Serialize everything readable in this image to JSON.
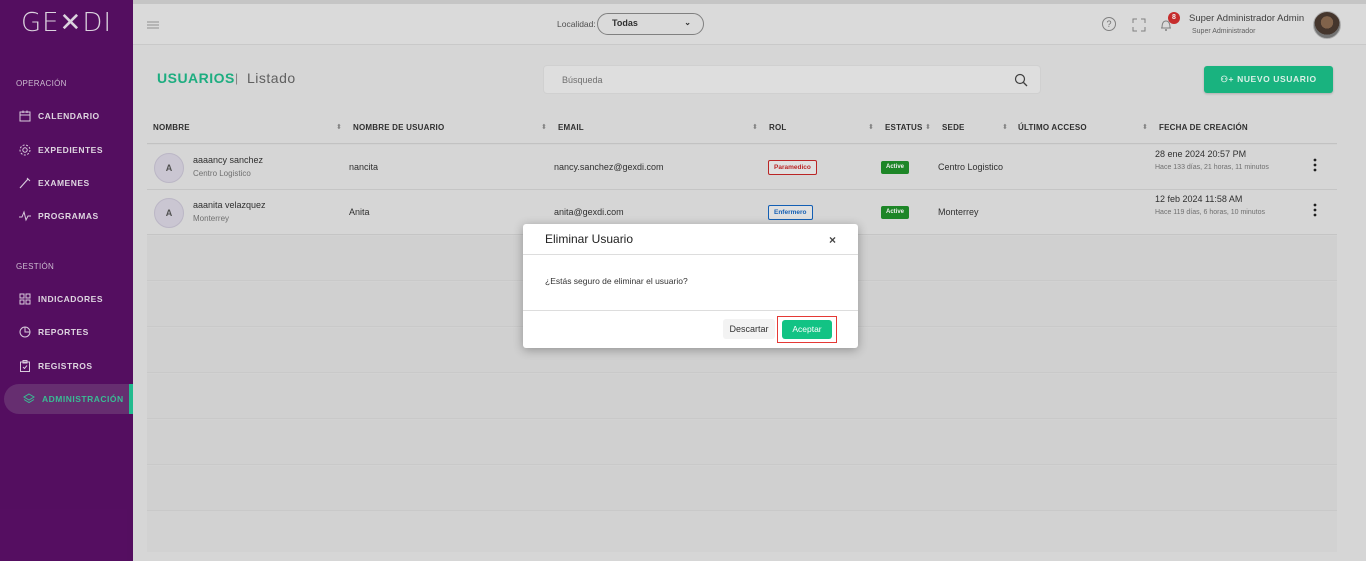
{
  "app": {
    "logo": "GE✕DI"
  },
  "sidebar": {
    "sections": [
      {
        "title": "OPERACIÓN"
      },
      {
        "title": "GESTIÓN"
      }
    ],
    "items": [
      {
        "label": "CALENDARIO",
        "icon": "calendar-icon"
      },
      {
        "label": "EXPEDIENTES",
        "icon": "gear-icon"
      },
      {
        "label": "EXAMENES",
        "icon": "pen-icon"
      },
      {
        "label": "PROGRAMAS",
        "icon": "pulse-icon"
      },
      {
        "label": "INDICADORES",
        "icon": "grid-icon"
      },
      {
        "label": "REPORTES",
        "icon": "pie-icon"
      },
      {
        "label": "REGISTROS",
        "icon": "clipboard-icon"
      },
      {
        "label": "ADMINISTRACIÓN",
        "icon": "layers-icon",
        "active": true
      }
    ]
  },
  "topbar": {
    "location_label": "Localidad:",
    "location_value": "Todas",
    "notifications": "8",
    "user_name": "Super Administrador Admin",
    "user_role": "Super Administrador"
  },
  "page": {
    "title": "USUARIOS",
    "separator": "|",
    "subtitle": "Listado",
    "search_placeholder": "Búsqueda",
    "new_button": "NUEVO USUARIO"
  },
  "table": {
    "columns": [
      "NOMBRE",
      "NOMBRE DE USUARIO",
      "EMAIL",
      "ROL",
      "ESTATUS",
      "SEDE",
      "ÚLTIMO ACCESO",
      "FECHA DE CREACIÓN"
    ],
    "rows": [
      {
        "initial": "A",
        "name": "aaaancy sanchez",
        "site_sub": "Centro Logistico",
        "username": "nancita",
        "email": "nancy.sanchez@gexdi.com",
        "role": "Paramedico",
        "status": "Active",
        "site": "Centro Logistico",
        "created": "28 ene 2024 20:57 PM",
        "created_ago": "Hace 133 días, 21 horas, 11 minutos"
      },
      {
        "initial": "A",
        "name": "aaanita velazquez",
        "site_sub": "Monterrey",
        "username": "Anita",
        "email": "anita@gexdi.com",
        "role": "Enfermero",
        "status": "Active",
        "site": "Monterrey",
        "created": "12 feb 2024 11:58 AM",
        "created_ago": "Hace 119 días, 6 horas, 10 minutos"
      }
    ]
  },
  "dialog": {
    "title": "Eliminar Usuario",
    "close": "×",
    "message": "¿Estás seguro de eliminar el usuario?",
    "cancel": "Descartar",
    "accept": "Aceptar"
  },
  "colors": {
    "sidebar": "#5a0f67",
    "accent": "#1bbf87",
    "danger": "#c62828",
    "info": "#1565c0"
  }
}
